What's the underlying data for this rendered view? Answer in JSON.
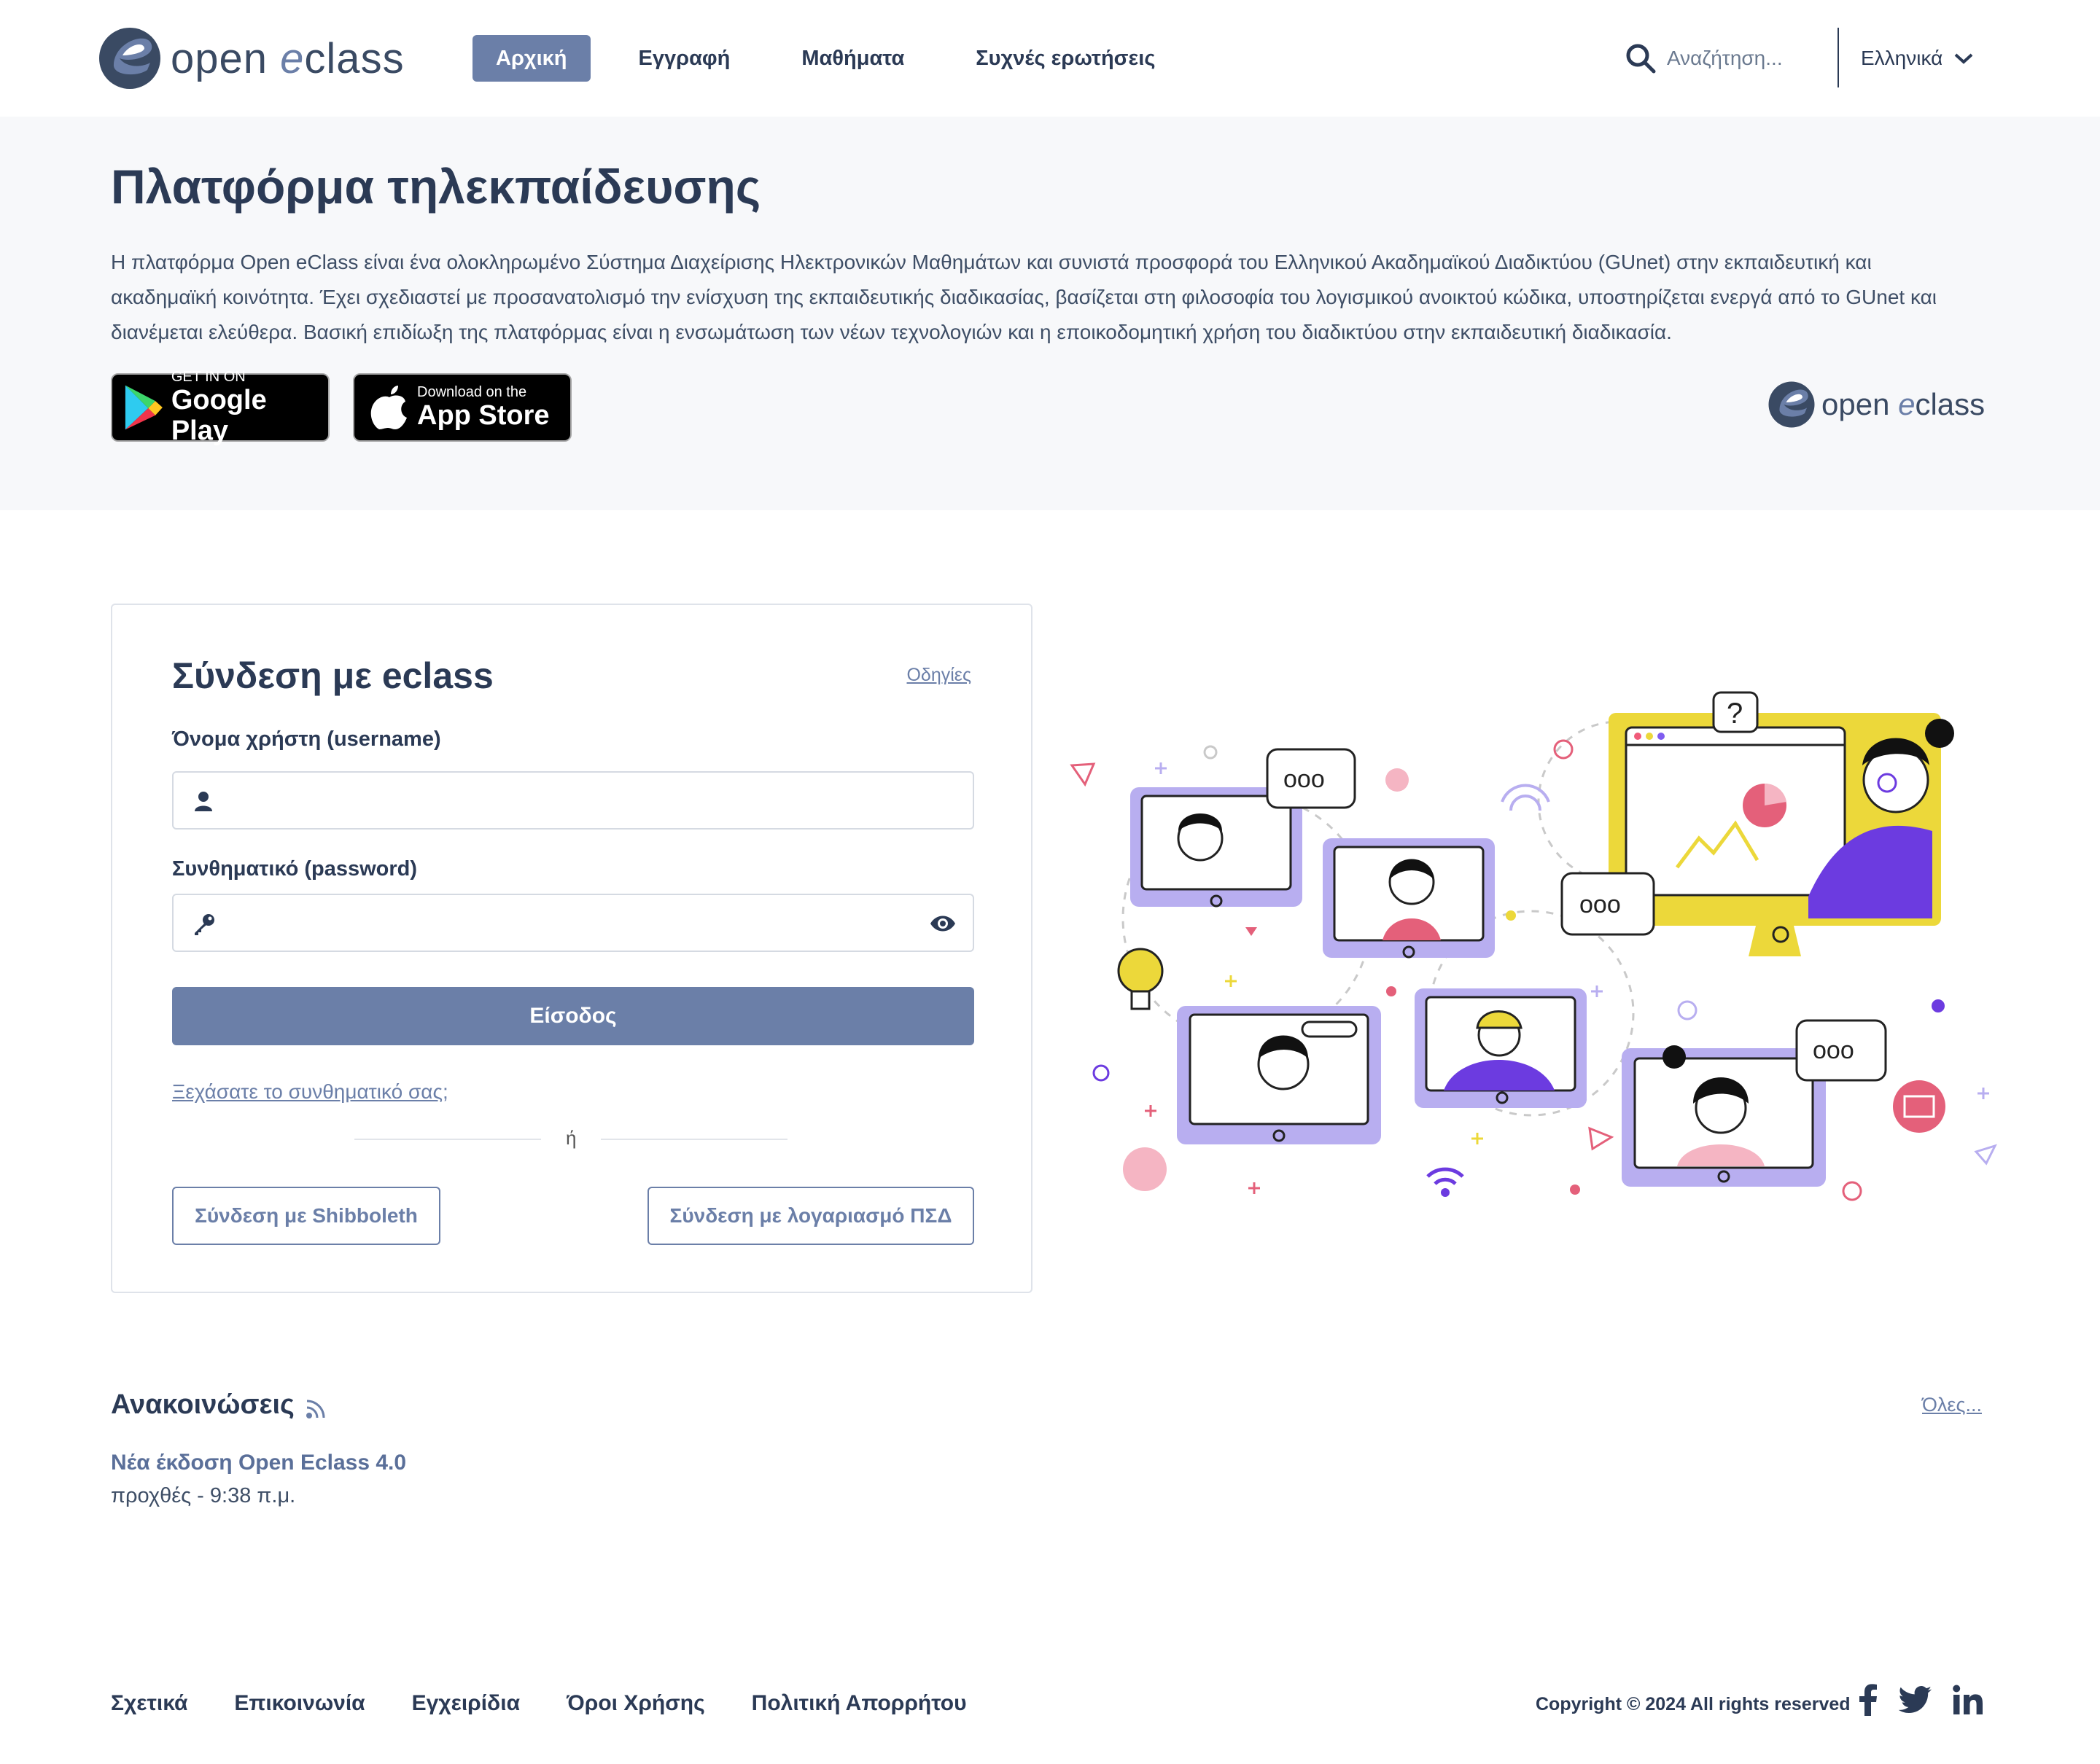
{
  "header": {
    "logo_text_1": "open ",
    "logo_text_2": "e",
    "logo_text_3": "class",
    "nav": [
      {
        "label": "Αρχική",
        "active": true
      },
      {
        "label": "Εγγραφή"
      },
      {
        "label": "Μαθήματα"
      },
      {
        "label": "Συχνές ερωτήσεις"
      }
    ],
    "search_placeholder": "Αναζήτηση...",
    "language": "Ελληνικά"
  },
  "hero": {
    "title": "Πλατφόρμα τηλεκπαίδευσης",
    "description": "Η πλατφόρμα Open eClass είναι ένα ολοκληρωμένο Σύστημα Διαχείρισης Ηλεκτρονικών Μαθημάτων και συνιστά προσφορά του Ελληνικού Ακαδημαϊκού Διαδικτύου (GUnet) στην εκπαιδευτική και ακαδημαϊκή κοινότητα. Έχει σχεδιαστεί με προσανατολισμό την ενίσχυση της εκπαιδευτικής διαδικασίας, βασίζεται στη φιλοσοφία του λογισμικού ανοικτού κώδικα, υποστηρίζεται ενεργά από το GUnet και διανέμεται ελεύθερα. Βασική επιδίωξη της πλατφόρμας είναι η ενσωμάτωση των νέων τεχνολογιών και η εποικοδομητική χρήση του διαδικτύου στην εκπαιδευτική διαδικασία.",
    "google_play_small": "GET IN ON",
    "google_play_big": "Google Play",
    "app_store_small": "Download on the",
    "app_store_big": "App Store"
  },
  "login": {
    "title": "Σύνδεση με eclass",
    "help_link": "Οδηγίες",
    "username_label": "Όνομα χρήστη (username)",
    "username_value": "",
    "password_label": "Συνθηματικό (password)",
    "password_value": "",
    "submit": "Είσοδος",
    "forgot_link": "Ξεχάσατε το συνθηματικό σας",
    "forgot_suffix": ";",
    "or": "ή",
    "shibboleth": "Σύνδεση με Shibboleth",
    "psd": "Σύνδεση με λογαριασμό ΠΣΔ"
  },
  "illustration": {
    "bubble_text": "ooo",
    "question": "?"
  },
  "announcements": {
    "title": "Ανακοινώσεις",
    "all_link": "Όλες...",
    "items": [
      {
        "title": "Νέα έκδοση Open Eclass 4.0",
        "date": "προχθές - 9:38 π.μ."
      }
    ]
  },
  "footer": {
    "links": [
      "Σχετικά",
      "Επικοινωνία",
      "Εγχειρίδια",
      "Όροι Χρήσης",
      "Πολιτική Απορρήτου"
    ],
    "copyright": "Copyright © 2024 All rights reserved",
    "social": [
      "facebook-icon",
      "twitter-icon",
      "linkedin-icon"
    ]
  },
  "colors": {
    "primary": "#6b7fa8",
    "text": "#2b3a55",
    "hero_bg": "#f7f8fa",
    "illus_purple": "#b8aef0",
    "illus_yellow": "#ecd83a"
  }
}
